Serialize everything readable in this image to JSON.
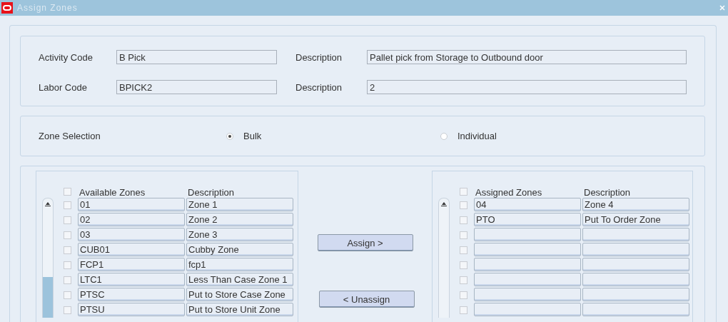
{
  "window": {
    "title": "Assign Zones"
  },
  "header": {
    "fields": [
      {
        "label": "Activity Code",
        "value": "B Pick",
        "description_label": "Description",
        "description": "Pallet pick from Storage to Outbound door"
      },
      {
        "label": "Labor Code",
        "value": "BPICK2",
        "description_label": "Description",
        "description": "2"
      }
    ]
  },
  "zone_selection": {
    "label": "Zone Selection",
    "options": [
      {
        "label": "Bulk",
        "selected": true
      },
      {
        "label": "Individual",
        "selected": false
      }
    ]
  },
  "available_zones": {
    "columns": [
      "Available Zones",
      "Description"
    ],
    "header_checked": false,
    "rows": [
      {
        "code": "01",
        "description": "Zone 1",
        "checked": false
      },
      {
        "code": "02",
        "description": "Zone 2",
        "checked": false
      },
      {
        "code": "03",
        "description": "Zone 3",
        "checked": false
      },
      {
        "code": "CUB01",
        "description": "Cubby Zone",
        "checked": false
      },
      {
        "code": "FCP1",
        "description": "fcp1",
        "checked": false
      },
      {
        "code": "LTC1",
        "description": "Less Than Case Zone 1",
        "checked": false
      },
      {
        "code": "PTSC",
        "description": "Put to Store Case Zone",
        "checked": false
      },
      {
        "code": "PTSU",
        "description": "Put to Store Unit Zone",
        "checked": false
      }
    ]
  },
  "buttons": [
    "Assign >",
    "< Unassign"
  ],
  "assigned_zones": {
    "columns": [
      "Assigned Zones",
      "Description"
    ],
    "header_checked": false,
    "rows": [
      {
        "code": "04",
        "description": "Zone 4",
        "checked": false
      },
      {
        "code": "PTO",
        "description": "Put To Order Zone",
        "checked": false
      },
      {
        "checked": false
      },
      {
        "checked": false
      },
      {
        "checked": false
      },
      {
        "checked": false
      },
      {
        "checked": false
      },
      {
        "checked": false
      }
    ]
  }
}
